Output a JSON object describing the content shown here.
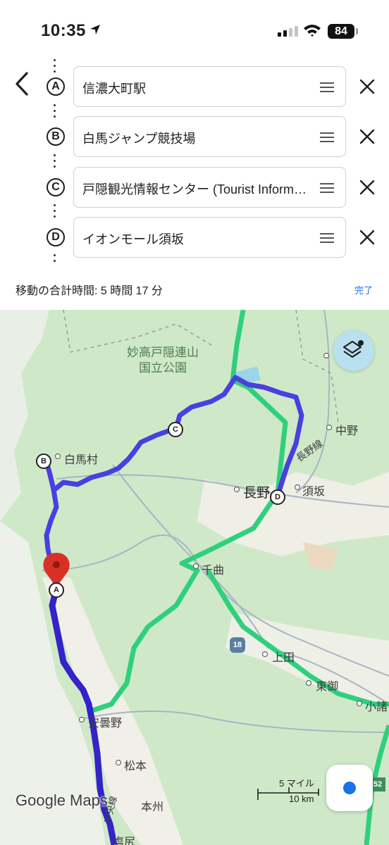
{
  "status_bar": {
    "time": "10:35",
    "battery": "84"
  },
  "stops": [
    {
      "letter": "A",
      "name": "信濃大町駅"
    },
    {
      "letter": "B",
      "name": "白馬ジャンプ競技場"
    },
    {
      "letter": "C",
      "name": "戸隠観光情報センター (Tourist Information Center)"
    },
    {
      "letter": "D",
      "name": "イオンモール須坂"
    }
  ],
  "summary": {
    "total_time": "移動の合計時間: 5 時間 17 分",
    "done_label": "完了"
  },
  "map": {
    "labels": {
      "park": "妙高戸隠連山\n国立公園",
      "hakuba": "白馬村",
      "nagano": "長野",
      "suzaka": "須坂",
      "nakano": "中野",
      "nagano_line": "長野線",
      "chikuma": "千曲",
      "ueda": "上田",
      "tomi": "東御",
      "komoro": "小諸",
      "azumino": "安曇野",
      "matsumoto": "松本",
      "honshu": "本州",
      "chuo_line": "中央線",
      "shiojiri": "塩尻"
    },
    "route_shield": "18",
    "route_shield2": "52",
    "scale_mi": "5 マイル",
    "scale_km": "10 km",
    "logo": "Google Maps",
    "route_color": "#4a3fe0",
    "highway_color": "#2fd07c",
    "pin_color": "#d93025"
  }
}
